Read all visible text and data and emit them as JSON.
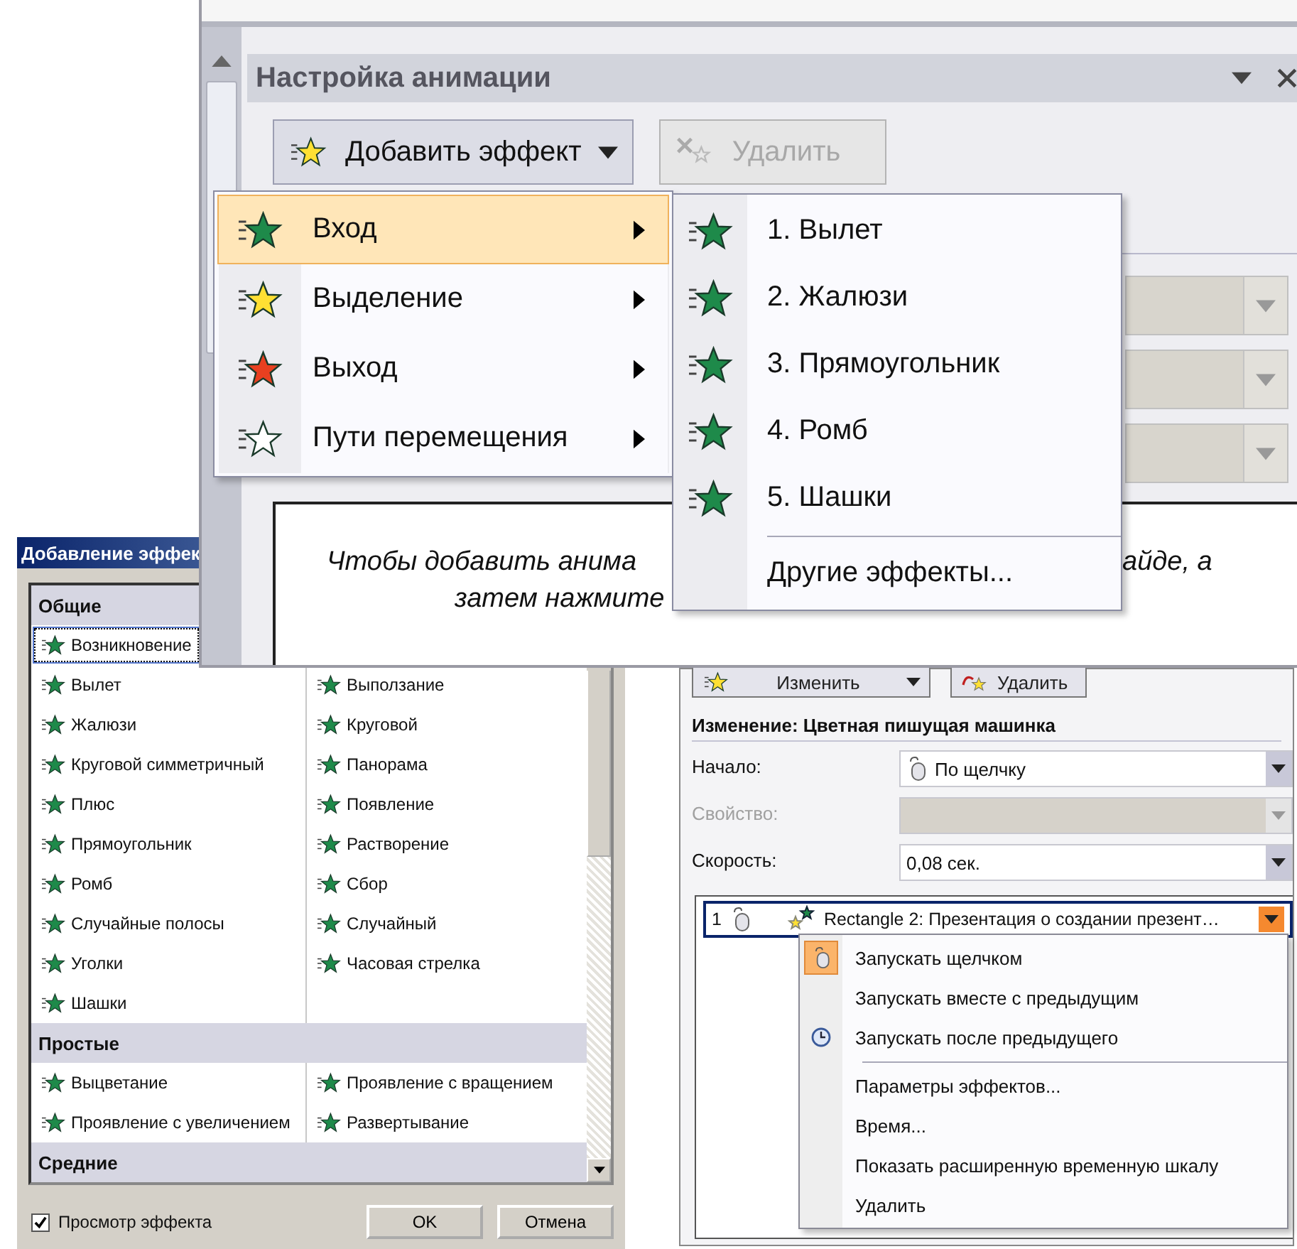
{
  "task_pane": {
    "title": "Настройка анимации",
    "add_button": "Добавить эффект",
    "remove_button": {
      "label": "Удалить",
      "disabled": true
    },
    "hint": [
      {
        "kind": "line1_left",
        "text": "Чтобы добавить анима"
      },
      {
        "kind": "line1_right",
        "text": "айде, а"
      },
      {
        "kind": "line2",
        "text": "затем нажмите"
      }
    ],
    "add_menu": [
      {
        "label": "Вход",
        "kind": "entrance",
        "selected": true
      },
      {
        "label": "Выделение",
        "kind": "emphasis",
        "selected": false
      },
      {
        "label": "Выход",
        "kind": "exit",
        "selected": false
      },
      {
        "label": "Пути перемещения",
        "kind": "path",
        "selected": false
      }
    ],
    "entrance_submenu": {
      "items": [
        "1. Вылет",
        "2. Жалюзи",
        "3. Прямоугольник",
        "4. Ромб",
        "5. Шашки"
      ],
      "more": "Другие эффекты..."
    }
  },
  "add_effect_dialog": {
    "title": "Добавление эффек",
    "groups": [
      {
        "title": "Общие",
        "rows": [
          {
            "left": {
              "label": "Возникновение",
              "selected": true
            }
          },
          {
            "left": {
              "label": "Вылет",
              "selected": false
            },
            "right": {
              "label": "Выползание",
              "selected": false
            }
          },
          {
            "left": {
              "label": "Жалюзи",
              "selected": false
            },
            "right": {
              "label": "Круговой",
              "selected": false
            }
          },
          {
            "left": {
              "label": "Круговой симметричный",
              "selected": false
            },
            "right": {
              "label": "Панорама",
              "selected": false
            }
          },
          {
            "left": {
              "label": "Плюс",
              "selected": false
            },
            "right": {
              "label": "Появление",
              "selected": false
            }
          },
          {
            "left": {
              "label": "Прямоугольник",
              "selected": false
            },
            "right": {
              "label": "Растворение",
              "selected": false
            }
          },
          {
            "left": {
              "label": "Ромб",
              "selected": false
            },
            "right": {
              "label": "Сбор",
              "selected": false
            }
          },
          {
            "left": {
              "label": "Случайные полосы",
              "selected": false
            },
            "right": {
              "label": "Случайный",
              "selected": false
            }
          },
          {
            "left": {
              "label": "Уголки",
              "selected": false
            },
            "right": {
              "label": "Часовая стрелка",
              "selected": false
            }
          },
          {
            "left": {
              "label": "Шашки",
              "selected": false
            }
          }
        ]
      },
      {
        "title": "Простые",
        "rows": [
          {
            "left": {
              "label": "Выцветание",
              "selected": false
            },
            "right": {
              "label": "Проявление с вращением",
              "selected": false
            }
          },
          {
            "left": {
              "label": "Проявление с увеличением",
              "selected": false
            },
            "right": {
              "label": "Развертывание",
              "selected": false
            }
          }
        ]
      },
      {
        "title": "Средние"
      }
    ],
    "preview": {
      "label": "Просмотр эффекта",
      "checked": true
    },
    "buttons": [
      "OK",
      "Отмена"
    ]
  },
  "modify_pane": {
    "change_button": "Изменить",
    "remove_button": "Удалить",
    "heading": "Изменение: Цветная пишущая машинка",
    "fields": [
      {
        "label": "Начало:",
        "value": "По щелчку",
        "kind": "mouse",
        "disabled": false
      },
      {
        "label": "Свойство:",
        "kind": "plain",
        "disabled": true
      },
      {
        "label": "Скорость:",
        "value": "0,08 сек.",
        "kind": "plain",
        "disabled": false
      }
    ],
    "list_item": {
      "number": "1",
      "text": "Rectangle 2: Презентация о создании презент…",
      "selected": true
    },
    "start_options": [
      {
        "label": "Запускать щелчком",
        "kind": "click",
        "checked": true
      },
      {
        "label": "Запускать вместе с предыдущим",
        "kind": "with",
        "checked": false
      },
      {
        "label": "Запускать после предыдущего",
        "kind": "after",
        "checked": false
      }
    ],
    "actions": [
      "Параметры эффектов...",
      "Время...",
      "Показать расширенную временную шкалу",
      "Удалить"
    ]
  }
}
